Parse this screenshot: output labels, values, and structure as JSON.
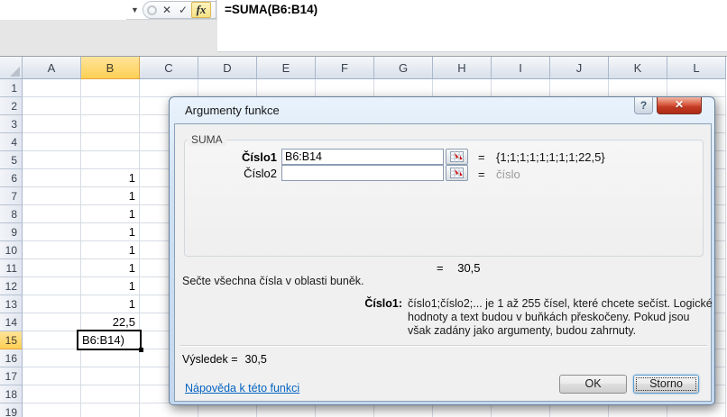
{
  "formula_bar": {
    "name_box_value": "",
    "formula_text": "=SUMA(B6:B14)",
    "icons": {
      "dropdown": "▼",
      "cancel": "✕",
      "enter": "✓",
      "insert_function": "fx"
    }
  },
  "grid": {
    "column_headers": [
      "A",
      "B",
      "C",
      "D",
      "E",
      "F",
      "G",
      "H",
      "I",
      "J",
      "K",
      "L"
    ],
    "row_count": 19,
    "selected_column": "B",
    "selected_row": 15,
    "cells": {
      "B6": "1",
      "B7": "1",
      "B8": "1",
      "B9": "1",
      "B10": "1",
      "B11": "1",
      "B12": "1",
      "B13": "1",
      "B14": "22,5"
    },
    "edit_cell": {
      "ref": "B15",
      "text": "B6:B14)"
    }
  },
  "dialog": {
    "title": "Argumenty funkce",
    "help_button": "?",
    "close_button": "✕",
    "group_label": "SUMA",
    "args": [
      {
        "label": "Číslo1",
        "value": "B6:B14",
        "equals": "=",
        "result": "{1;1;1;1;1;1;1;1;22,5}"
      },
      {
        "label": "Číslo2",
        "value": "",
        "equals": "=",
        "result": "číslo"
      }
    ],
    "total_equals": "=",
    "total_value": "30,5",
    "summary": "Sečte všechna čísla v oblasti buněk.",
    "arg_help_label": "Číslo1:",
    "arg_help_text": "číslo1;číslo2;... je 1 až 255 čísel, které chcete sečíst. Logické hodnoty a text budou v buňkách přeskočeny. Pokud jsou však zadány jako argumenty, budou zahrnuty.",
    "result_label": "Výsledek =",
    "result_value": "30,5",
    "help_link": "Nápověda k této funkci",
    "ok_label": "OK",
    "cancel_label": "Storno"
  }
}
